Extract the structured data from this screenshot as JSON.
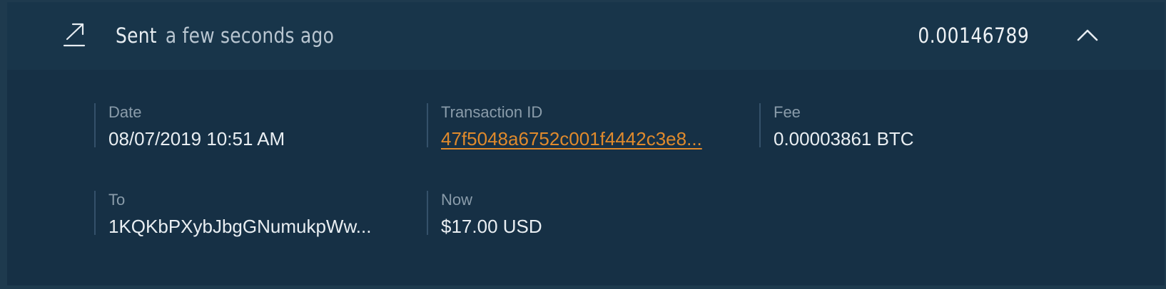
{
  "transaction": {
    "direction": "Sent",
    "time_ago": "a few seconds ago",
    "amount": "0.00146789",
    "icon": "arrow-up-right-icon",
    "toggle_icon": "chevron-up-icon"
  },
  "details": {
    "date": {
      "label": "Date",
      "value": "08/07/2019 10:51 AM"
    },
    "transaction_id": {
      "label": "Transaction ID",
      "value": "47f5048a6752c001f4442c3e8..."
    },
    "fee": {
      "label": "Fee",
      "value": "0.00003861 BTC"
    },
    "to": {
      "label": "To",
      "value": "1KQKbPXybJbgGNumukpWw..."
    },
    "now": {
      "label": "Now",
      "value": "$17.00 USD"
    }
  },
  "colors": {
    "background": "#163045",
    "header": "#18354a",
    "link": "#e08a2c",
    "label": "#8a9caa",
    "text": "#e9eef2"
  }
}
